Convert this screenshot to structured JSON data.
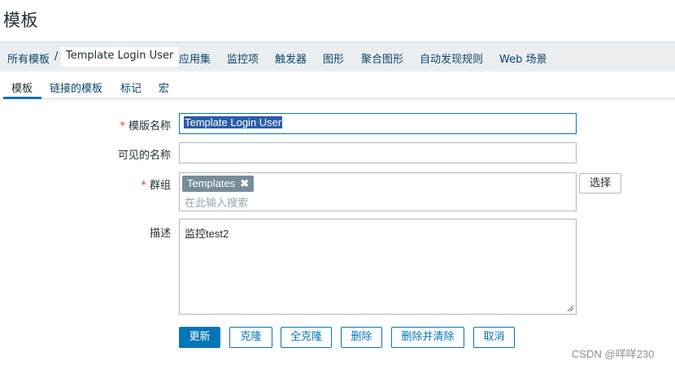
{
  "page": {
    "title": "模板"
  },
  "breadcrumb": {
    "all_templates": "所有模板",
    "separator": "/",
    "current": "Template Login User",
    "links": [
      "应用集",
      "监控项",
      "触发器",
      "图形",
      "聚合图形",
      "自动发现规则",
      "Web 场景"
    ]
  },
  "tabs": [
    "模板",
    "链接的模板",
    "标记",
    "宏"
  ],
  "form": {
    "template_name": {
      "required_mark": "*",
      "label": "模版名称",
      "value": "Template Login User"
    },
    "visible_name": {
      "label": "可见的名称",
      "value": ""
    },
    "groups": {
      "required_mark": "*",
      "label": "群组",
      "chip": "Templates",
      "chip_remove": "✖",
      "placeholder": "在此输入搜索",
      "select_button": "选择"
    },
    "description": {
      "label": "描述",
      "value": "监控test2"
    }
  },
  "buttons": {
    "update": "更新",
    "clone": "克隆",
    "full_clone": "全克隆",
    "delete": "删除",
    "delete_and_clear": "删除并清除",
    "cancel": "取消"
  },
  "watermark": "CSDN @咩咩230",
  "colors": {
    "accent": "#0275b8",
    "required": "#e33734",
    "chip": "#768d99"
  }
}
